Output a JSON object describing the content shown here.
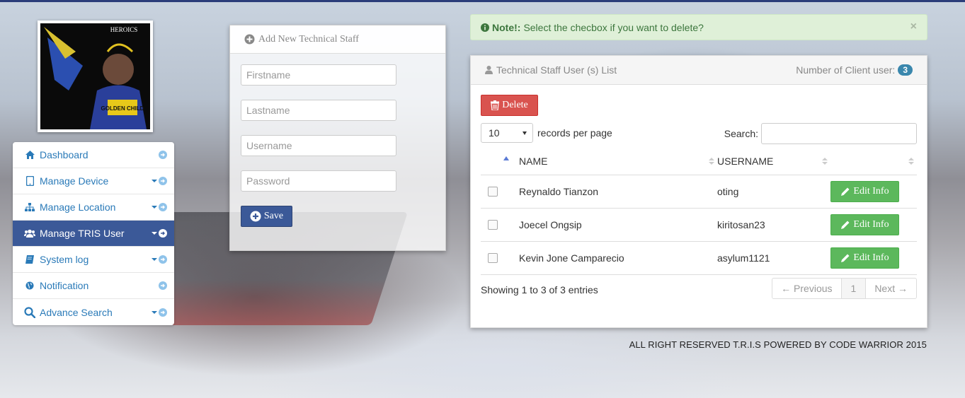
{
  "logo": {
    "brand": "HEROICS",
    "caption": "GOLDEN CHILD"
  },
  "sidebar": {
    "items": [
      {
        "label": "Dashboard",
        "icon": "home-icon"
      },
      {
        "label": "Manage Device",
        "icon": "tablet-icon"
      },
      {
        "label": "Manage Location",
        "icon": "sitemap-icon"
      },
      {
        "label": "Manage TRIS User",
        "icon": "users-icon"
      },
      {
        "label": "System log",
        "icon": "book-icon"
      },
      {
        "label": "Notification",
        "icon": "globe-icon"
      },
      {
        "label": "Advance Search",
        "icon": "search-icon"
      }
    ]
  },
  "add_form": {
    "title": "Add New Technical Staff",
    "firstname_placeholder": "Firstname",
    "lastname_placeholder": "Lastname",
    "username_placeholder": "Username",
    "password_placeholder": "Password",
    "save_label": "Save"
  },
  "note": {
    "title": "Note!:",
    "message": "Select the checbox if you want to delete?",
    "close": "×"
  },
  "list": {
    "title": "Technical Staff User (s) List",
    "count_label": "Number of Client user:",
    "count": "3",
    "delete_label": "Delete",
    "page_length": "10",
    "records_label": "records per page",
    "search_label": "Search:",
    "columns": [
      "NAME",
      "USERNAME"
    ],
    "rows": [
      {
        "name": "Reynaldo Tianzon",
        "username": "oting",
        "action": "Edit Info"
      },
      {
        "name": "Joecel Ongsip",
        "username": "kiritosan23",
        "action": "Edit Info"
      },
      {
        "name": "Kevin Jone Camparecio",
        "username": "asylum1121",
        "action": "Edit Info"
      }
    ],
    "info": "Showing 1 to 3 of 3 entries",
    "prev": "Previous",
    "page": "1",
    "next": "Next"
  },
  "footer": "ALL RIGHT RESERVED T.R.I.S POWERED BY CODE WARRIOR 2015"
}
